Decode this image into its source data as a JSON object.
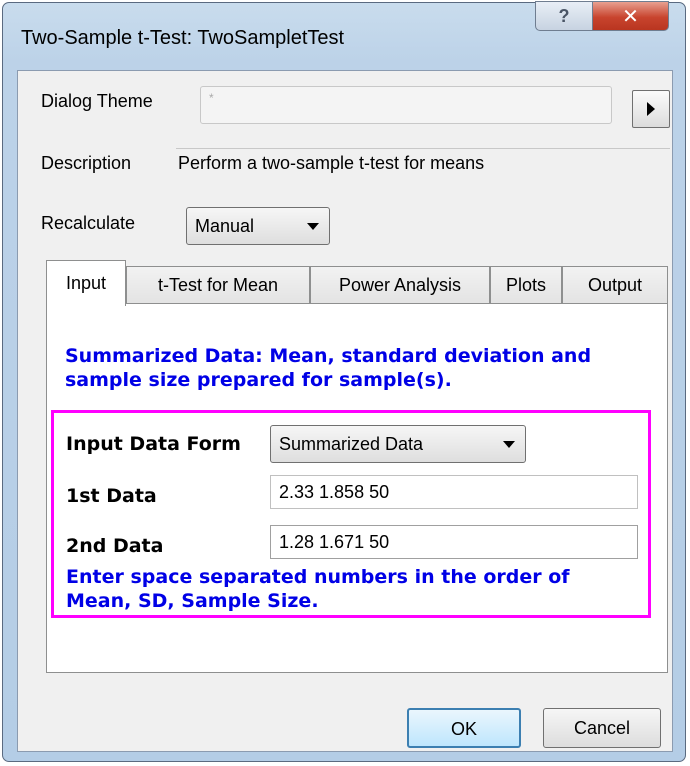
{
  "window": {
    "title": "Two-Sample t-Test: TwoSampletTest",
    "help_label": "?",
    "close_label": "✕"
  },
  "dialog_theme": {
    "label": "Dialog Theme",
    "value": "",
    "placeholder": "*",
    "arrow_icon": "triangle-right-icon"
  },
  "description": {
    "label": "Description",
    "value": "Perform a two-sample t-test for means"
  },
  "recalculate": {
    "label": "Recalculate",
    "selected": "Manual"
  },
  "tabs": [
    {
      "label": "Input",
      "active": true
    },
    {
      "label": "t-Test for Mean",
      "active": false
    },
    {
      "label": "Power Analysis",
      "active": false
    },
    {
      "label": "Plots",
      "active": false
    },
    {
      "label": "Output",
      "active": false
    }
  ],
  "input_tab": {
    "summary_line1": "Summarized Data: Mean, standard deviation and",
    "summary_line2": "sample size prepared for sample(s).",
    "input_data_form": {
      "label": "Input Data Form",
      "selected": "Summarized Data"
    },
    "first_data": {
      "label": "1st Data",
      "value": "2.33 1.858 50"
    },
    "second_data": {
      "label": "2nd Data",
      "value": "1.28 1.671 50"
    },
    "hint_line1": "Enter space separated numbers in the order of",
    "hint_line2": "Mean, SD, Sample Size.",
    "highlight_color": "#ff00ff",
    "info_text_color": "#0000e6"
  },
  "buttons": {
    "ok": "OK",
    "cancel": "Cancel"
  }
}
